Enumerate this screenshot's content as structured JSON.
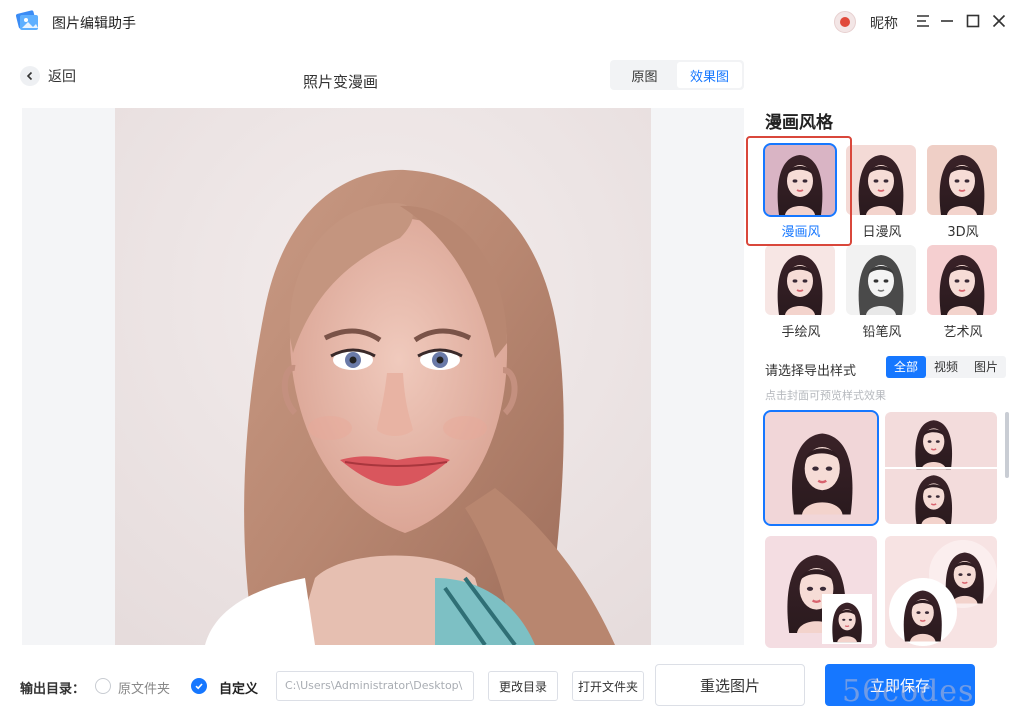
{
  "app": {
    "title": "图片编辑助手",
    "user_name": "昵称"
  },
  "header": {
    "back_label": "返回",
    "page_title": "照片变漫画",
    "view_tabs": [
      "原图",
      "效果图"
    ],
    "active_view": "效果图"
  },
  "panel": {
    "title": "漫画风格",
    "styles": [
      {
        "label": "漫画风",
        "active": true
      },
      {
        "label": "日漫风",
        "active": false
      },
      {
        "label": "3D风",
        "active": false
      },
      {
        "label": "手绘风",
        "active": false
      },
      {
        "label": "铅笔风",
        "active": false
      },
      {
        "label": "艺术风",
        "active": false
      }
    ],
    "export_label": "请选择导出样式",
    "filter_tabs": [
      "全部",
      "视频",
      "图片"
    ],
    "active_filter": "全部",
    "hint": "点击封面可预览样式效果"
  },
  "bottom": {
    "output_label": "输出目录：",
    "option_original": "原文件夹",
    "option_custom": "自定义",
    "path_value": "C:\\Users\\Administrator\\Desktop\\",
    "change_dir": "更改目录",
    "open_folder": "打开文件夹",
    "reselect": "重选图片",
    "save": "立即保存"
  },
  "watermark": "56codes",
  "colors": {
    "accent": "#1677ff",
    "highlight": "#d9473b"
  }
}
